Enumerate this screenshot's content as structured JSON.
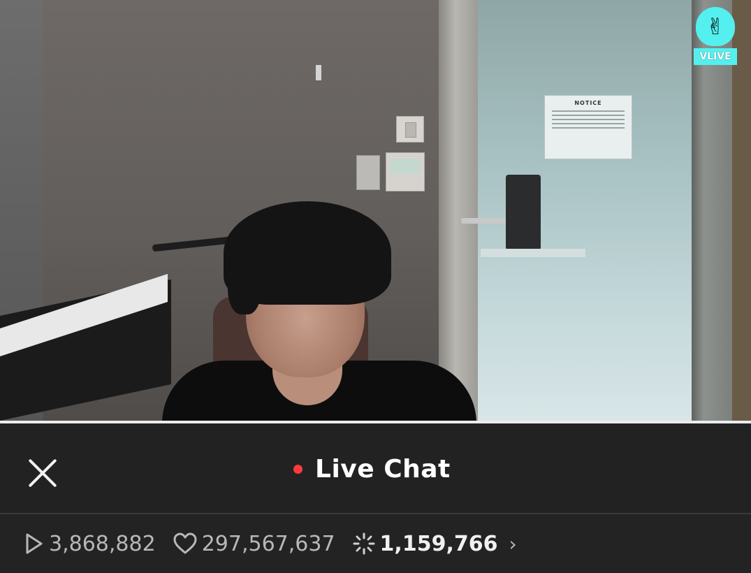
{
  "video": {
    "logo_text": "VLIVE",
    "notice_title": "NOTICE"
  },
  "chat_header": {
    "title": "Live Chat",
    "live_color": "#ff3b3b"
  },
  "stats": {
    "plays": "3,868,882",
    "hearts": "297,567,637",
    "chats": "1,159,766"
  },
  "icons": [
    "close-icon",
    "live-dot-icon",
    "play-icon",
    "heart-icon",
    "chat-burst-icon",
    "chevron-right-icon"
  ]
}
